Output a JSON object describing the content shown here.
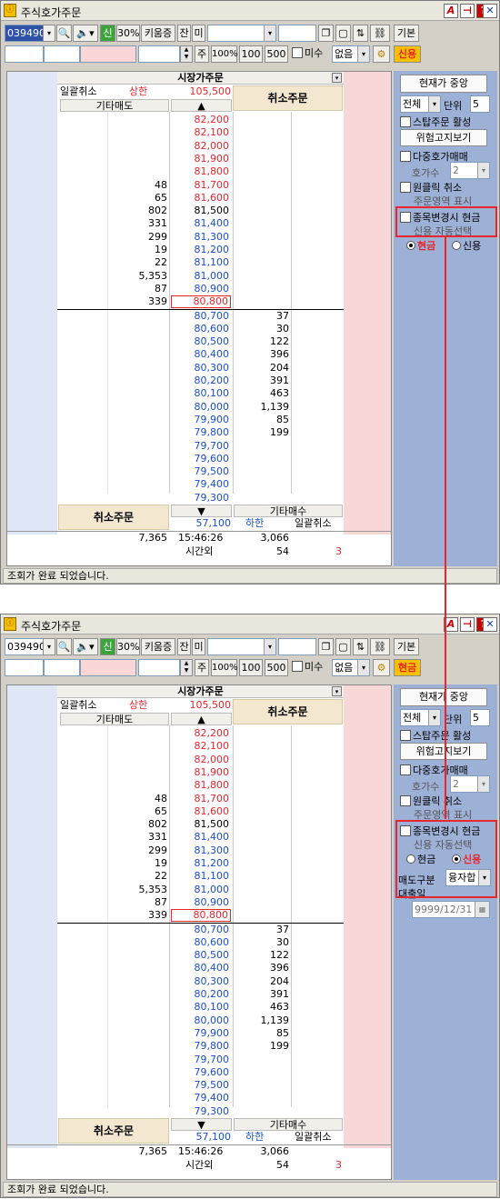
{
  "title": "주식호가주문",
  "code": "039490",
  "toolbar": {
    "sin": "신",
    "pct30": "30%",
    "kiwoom": "키움증",
    "jan": "잔",
    "mi": "미",
    "basic": "기본",
    "ju": "주",
    "q100pct": "100%",
    "q100": "100",
    "q500": "500",
    "misu": "미수",
    "none": "없음"
  },
  "mode_badge": [
    "신용",
    "현금"
  ],
  "book": {
    "market_order": "시장가주문",
    "cancel_all_top": "일괄취소",
    "upper": "상한",
    "upper_price": "105,500",
    "cancel_order_top": "취소주문",
    "other_sell": "기타매도",
    "up": "▲",
    "down": "▼",
    "asks": [
      {
        "p": "82,200",
        "q": ""
      },
      {
        "p": "82,100",
        "q": ""
      },
      {
        "p": "82,000",
        "q": ""
      },
      {
        "p": "81,900",
        "q": ""
      },
      {
        "p": "81,800",
        "q": ""
      },
      {
        "p": "81,700",
        "q": "48"
      },
      {
        "p": "81,600",
        "q": "65"
      },
      {
        "p": "81,500",
        "q": "802"
      },
      {
        "p": "81,400",
        "q": "331"
      },
      {
        "p": "81,300",
        "q": "299"
      },
      {
        "p": "81,200",
        "q": "19"
      },
      {
        "p": "81,100",
        "q": "22"
      },
      {
        "p": "81,000",
        "q": "5,353"
      },
      {
        "p": "80,900",
        "q": "87"
      },
      {
        "p": "80,800",
        "q": "339"
      }
    ],
    "bids": [
      {
        "p": "80,700",
        "q": "37"
      },
      {
        "p": "80,600",
        "q": "30"
      },
      {
        "p": "80,500",
        "q": "122"
      },
      {
        "p": "80,400",
        "q": "396"
      },
      {
        "p": "80,300",
        "q": "204"
      },
      {
        "p": "80,200",
        "q": "391"
      },
      {
        "p": "80,100",
        "q": "463"
      },
      {
        "p": "80,000",
        "q": "1,139"
      },
      {
        "p": "79,900",
        "q": "85"
      },
      {
        "p": "79,800",
        "q": "199"
      },
      {
        "p": "79,700",
        "q": ""
      },
      {
        "p": "79,600",
        "q": ""
      },
      {
        "p": "79,500",
        "q": ""
      },
      {
        "p": "79,400",
        "q": ""
      },
      {
        "p": "79,300",
        "q": ""
      }
    ],
    "cancel_order_bottom": "취소주문",
    "other_buy": "기타매수",
    "lower_price": "57,100",
    "lower": "하한",
    "cancel_all_bottom": "일괄취소",
    "total_ask": "7,365",
    "time": "15:46:26",
    "total_bid": "3,066",
    "after_hours": "시간외",
    "ah_val": "54",
    "ah_val2": "3"
  },
  "panel": {
    "center_btn": "현재가 중앙",
    "all": "전체",
    "unit": "단위",
    "unit_val": "5",
    "stop_order": "스탑주문 활성",
    "risk_btn": "위험고지보기",
    "multi": "다중호가매매",
    "levels": "호가수",
    "levels_val": "2",
    "oneclick": "원클릭 취소",
    "order_area": "주문영역 표시",
    "auto_cash": "종목변경시 현금",
    "auto_credit": "신용 자동선택",
    "cash": "현금",
    "credit": "신용",
    "sell_type": "매도구분",
    "sell_type_val": "융자합",
    "loan_date": "대출일",
    "loan_date_val": "9999/12/31"
  },
  "status": "조회가 완료 되었습니다.",
  "colors": {
    "up": "#e8262e",
    "down": "#1a4fd0",
    "highlight": "#e8262e"
  }
}
